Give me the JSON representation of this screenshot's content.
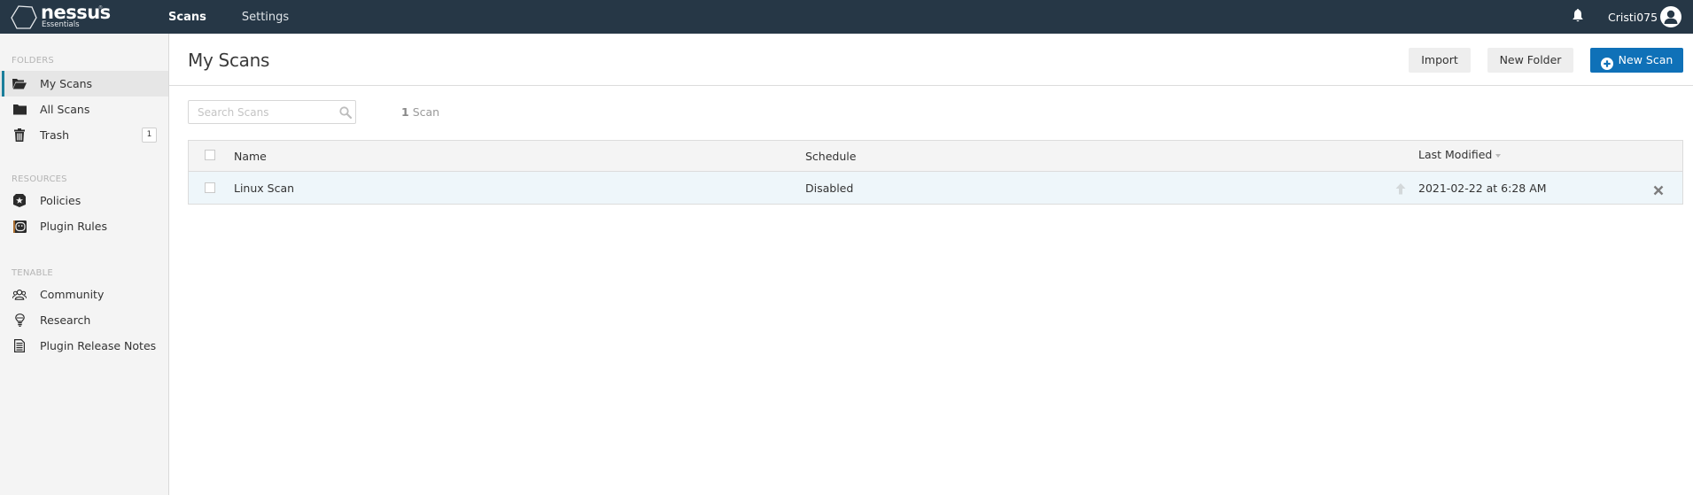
{
  "app": {
    "brand": "nessus",
    "edition": "Essentials",
    "trademark": "®"
  },
  "topnav": {
    "items": [
      {
        "label": "Scans",
        "active": true
      },
      {
        "label": "Settings",
        "active": false
      }
    ],
    "notifications_icon": "bell-icon",
    "username": "Cristi075",
    "avatar_icon": "user-avatar-icon"
  },
  "sidebar": {
    "sections": [
      {
        "label": "FOLDERS",
        "items": [
          {
            "label": "My Scans",
            "icon": "folder-open-icon",
            "active": true
          },
          {
            "label": "All Scans",
            "icon": "folder-icon",
            "active": false
          },
          {
            "label": "Trash",
            "icon": "trash-icon",
            "active": false,
            "badge": "1"
          }
        ]
      },
      {
        "label": "RESOURCES",
        "items": [
          {
            "label": "Policies",
            "icon": "shield-star-icon"
          },
          {
            "label": "Plugin Rules",
            "icon": "plugin-rules-icon"
          }
        ]
      },
      {
        "label": "TENABLE",
        "items": [
          {
            "label": "Community",
            "icon": "community-users-icon"
          },
          {
            "label": "Research",
            "icon": "lightbulb-icon"
          },
          {
            "label": "Plugin Release Notes",
            "icon": "document-icon"
          }
        ]
      }
    ]
  },
  "main": {
    "title": "My Scans",
    "buttons": {
      "import": "Import",
      "new_folder": "New Folder",
      "new_scan": "New Scan"
    },
    "search": {
      "placeholder": "Search Scans",
      "value": ""
    },
    "count": {
      "number": "1",
      "unit": "Scan"
    },
    "table": {
      "columns": [
        "Name",
        "Schedule",
        "Last Modified"
      ],
      "sort_column": "Last Modified",
      "sort_direction": "descending",
      "rows": [
        {
          "name": "Linux Scan",
          "schedule": "Disabled",
          "last_modified": "2021-02-22 at 6:28 AM"
        }
      ]
    }
  },
  "colors": {
    "topbar": "#263746",
    "accent_active": "#1a7e9b",
    "primary_button": "#0f71b8",
    "row_highlight": "#eef6fa"
  }
}
